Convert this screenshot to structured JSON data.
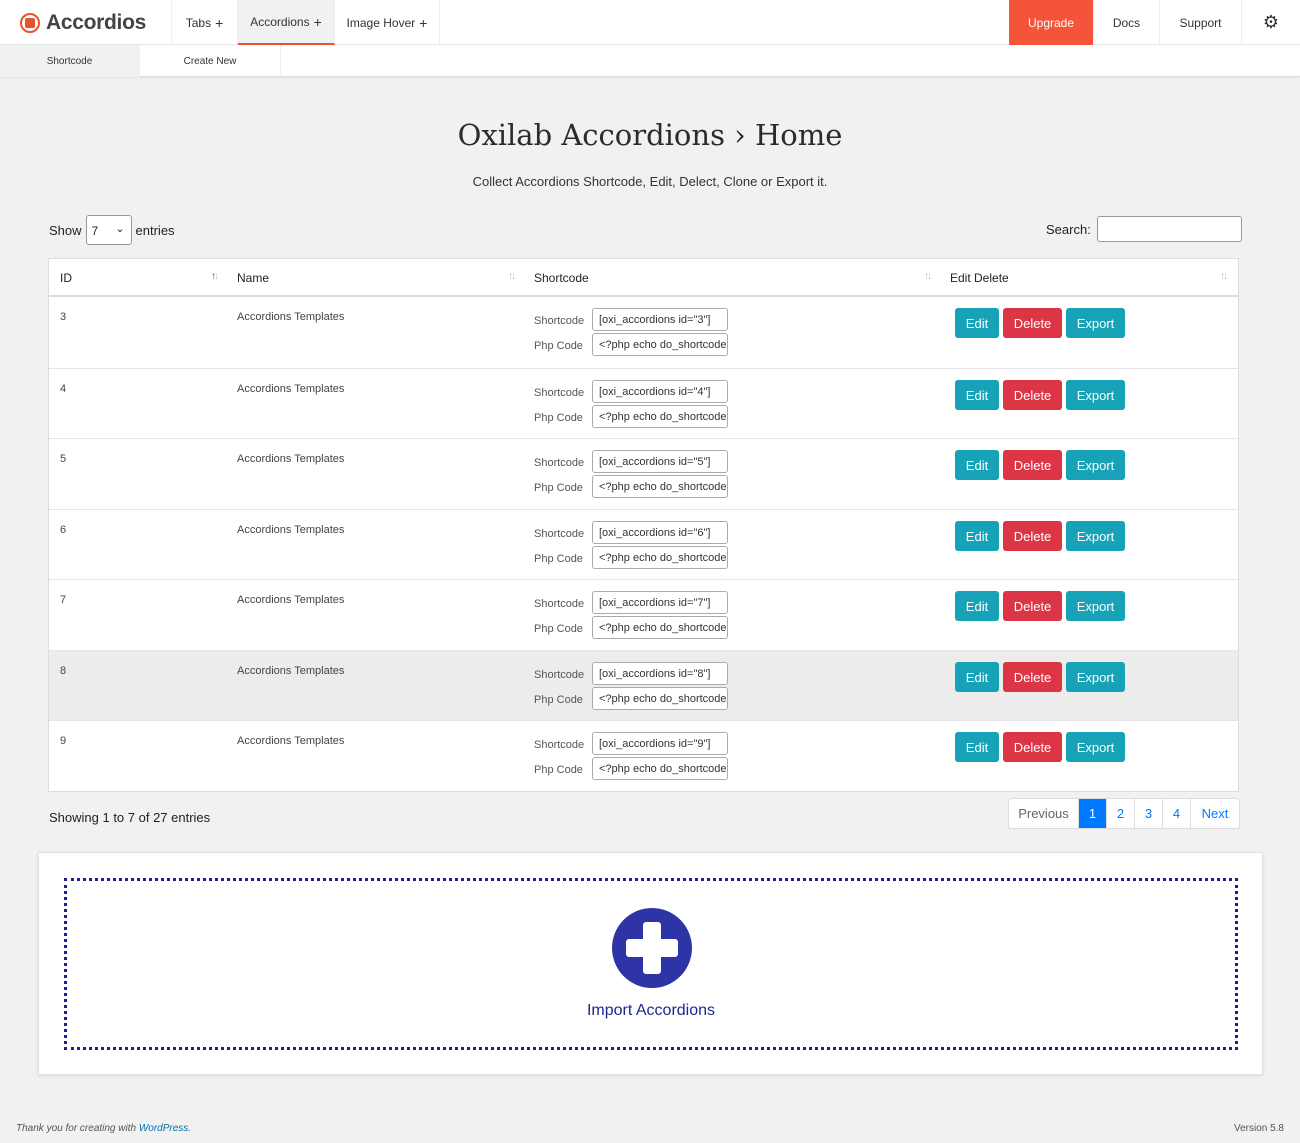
{
  "brand": {
    "name": "Accordios"
  },
  "nav": {
    "items": [
      {
        "label": "Tabs"
      },
      {
        "label": "Accordions"
      },
      {
        "label": "Image Hover"
      }
    ],
    "plus": "+",
    "upgrade": "Upgrade",
    "docs": "Docs",
    "support": "Support",
    "gear": "⚙"
  },
  "subnav": {
    "items": [
      {
        "label": "Shortcode"
      },
      {
        "label": "Create New"
      }
    ]
  },
  "page": {
    "title": "Oxilab Accordions › Home",
    "subtitle": "Collect Accordions Shortcode, Edit, Delect, Clone or Export it."
  },
  "controls": {
    "show_label": "Show",
    "entries_label": "entries",
    "page_size": "7",
    "search_label": "Search:",
    "search_value": ""
  },
  "table": {
    "columns": [
      "ID",
      "Name",
      "Shortcode",
      "Edit Delete"
    ],
    "shortcode_label": "Shortcode",
    "php_label": "Php Code",
    "edit_label": "Edit",
    "delete_label": "Delete",
    "export_label": "Export",
    "rows": [
      {
        "id": "3",
        "name": "Accordions Templates",
        "shortcode": "[oxi_accordions id=\"3\"]",
        "php": "<?php echo do_shortcode"
      },
      {
        "id": "4",
        "name": "Accordions Templates",
        "shortcode": "[oxi_accordions id=\"4\"]",
        "php": "<?php echo do_shortcode"
      },
      {
        "id": "5",
        "name": "Accordions Templates",
        "shortcode": "[oxi_accordions id=\"5\"]",
        "php": "<?php echo do_shortcode"
      },
      {
        "id": "6",
        "name": "Accordions Templates",
        "shortcode": "[oxi_accordions id=\"6\"]",
        "php": "<?php echo do_shortcode"
      },
      {
        "id": "7",
        "name": "Accordions Templates",
        "shortcode": "[oxi_accordions id=\"7\"]",
        "php": "<?php echo do_shortcode"
      },
      {
        "id": "8",
        "name": "Accordions Templates",
        "shortcode": "[oxi_accordions id=\"8\"]",
        "php": "<?php echo do_shortcode"
      },
      {
        "id": "9",
        "name": "Accordions Templates",
        "shortcode": "[oxi_accordions id=\"9\"]",
        "php": "<?php echo do_shortcode"
      }
    ]
  },
  "info": "Showing 1 to 7 of 27 entries",
  "pagination": {
    "previous": "Previous",
    "pages": [
      "1",
      "2",
      "3",
      "4"
    ],
    "current": "1",
    "next": "Next"
  },
  "import": {
    "label": "Import Accordions"
  },
  "footer": {
    "thanks": "Thank you for creating with",
    "link": "WordPress",
    "period": ".",
    "version": "Version 5.8"
  },
  "colors": {
    "accent": "#e8532f",
    "upgrade": "#f4543a",
    "teal": "#17a2b8",
    "danger": "#dc3545",
    "primary": "#007bff",
    "import": "#2e33a5"
  }
}
